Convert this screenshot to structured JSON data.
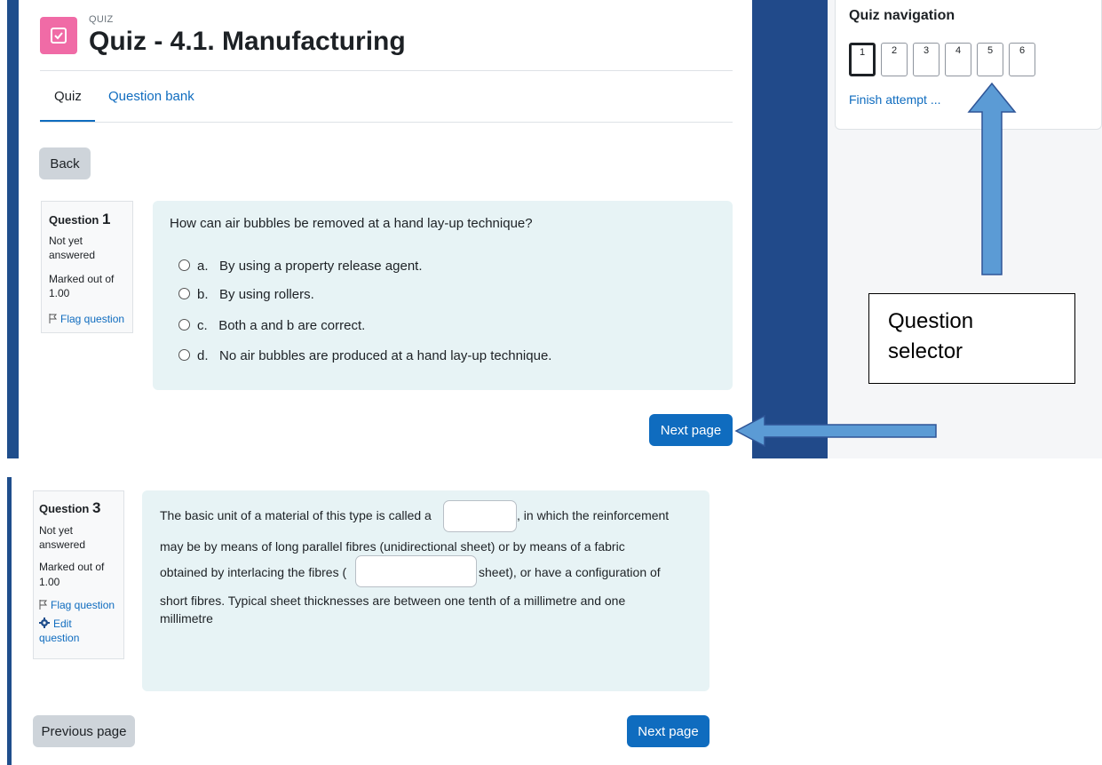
{
  "header": {
    "kicker": "QUIZ",
    "title": "Quiz - 4.1. Manufacturing",
    "icon": "checkbox-icon",
    "icon_color": "#f06ba6"
  },
  "tabs": [
    {
      "label": "Quiz",
      "active": true
    },
    {
      "label": "Question bank",
      "active": false
    }
  ],
  "back_label": "Back",
  "question1": {
    "label": "Question",
    "number": "1",
    "status": "Not yet answered",
    "marked_label": "Marked out of",
    "marked_value": "1.00",
    "flag_label": "Flag question",
    "text": "How can air bubbles be removed at a hand lay-up technique?",
    "options": [
      {
        "letter": "a.",
        "text": "By using a property release agent."
      },
      {
        "letter": "b.",
        "text": "By using rollers."
      },
      {
        "letter": "c.",
        "text": "Both a and b are correct."
      },
      {
        "letter": "d.",
        "text": "No air bubbles are produced at a hand lay-up technique."
      }
    ],
    "next_label": "Next page"
  },
  "question3": {
    "label": "Question",
    "number": "3",
    "status": "Not yet answered",
    "marked_label": "Marked out of",
    "marked_value": "1.00",
    "flag_label": "Flag question",
    "edit_label": "Edit question",
    "text_part1": "The basic unit of a material of this type is called a",
    "text_part2": ", in which the reinforcement",
    "text_line2": "may be by means of long parallel fibres (unidirectional sheet) or by means of a fabric",
    "text_part3": "obtained by interlacing the fibres (",
    "text_part4": "sheet), or have a configuration of",
    "text_line4": "short fibres. Typical sheet thicknesses are between one tenth of a millimetre and one",
    "text_line5": "millimetre",
    "prev_label": "Previous page",
    "next_label": "Next page"
  },
  "quiz_navigation": {
    "title": "Quiz navigation",
    "buttons": [
      "1",
      "2",
      "3",
      "4",
      "5",
      "6"
    ],
    "current": "1",
    "finish_label": "Finish attempt ..."
  },
  "annotation": {
    "callout_line1": "Question",
    "callout_line2": "selector",
    "arrow_color": "#5b9bd5"
  }
}
